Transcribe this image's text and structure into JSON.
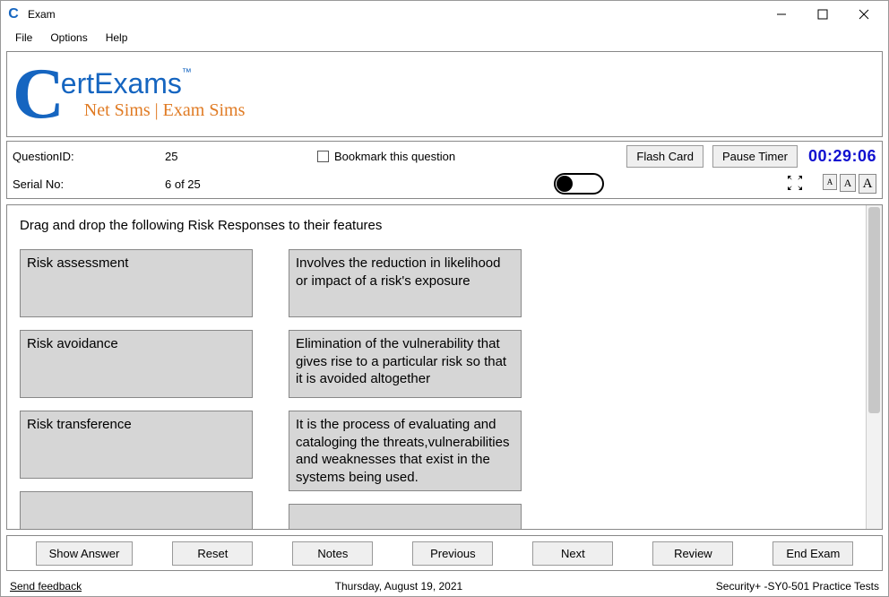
{
  "window": {
    "title": "Exam"
  },
  "menu": {
    "file": "File",
    "options": "Options",
    "help": "Help"
  },
  "logo": {
    "c_letter": "C",
    "main": "ertExams",
    "tm": "™",
    "sub": "Net Sims | Exam Sims"
  },
  "info": {
    "question_id_label": "QuestionID:",
    "question_id_value": "25",
    "serial_label": "Serial No:",
    "serial_value": "6 of 25",
    "bookmark_label": "Bookmark this question",
    "flash_card_btn": "Flash Card",
    "pause_timer_btn": "Pause Timer",
    "timer": "00:29:06",
    "font_small": "A",
    "font_medium": "A",
    "font_large": "A"
  },
  "question": {
    "prompt": "Drag and drop the following Risk Responses to their features",
    "left_items": [
      "Risk assessment",
      "Risk avoidance",
      "Risk transference"
    ],
    "right_items": [
      "Involves the reduction in likelihood or impact of a risk's exposure",
      "Elimination of the vulnerability that gives rise to a particular risk so that it is avoided altogether",
      "It is the process of evaluating and cataloging the threats,vulnerabilities and weaknesses that exist in the systems being used."
    ]
  },
  "nav": {
    "show_answer": "Show Answer",
    "reset": "Reset",
    "notes": "Notes",
    "previous": "Previous",
    "next": "Next",
    "review": "Review",
    "end_exam": "End Exam"
  },
  "status": {
    "feedback": "Send feedback",
    "date": "Thursday, August 19, 2021",
    "course": "Security+ -SY0-501 Practice Tests"
  }
}
